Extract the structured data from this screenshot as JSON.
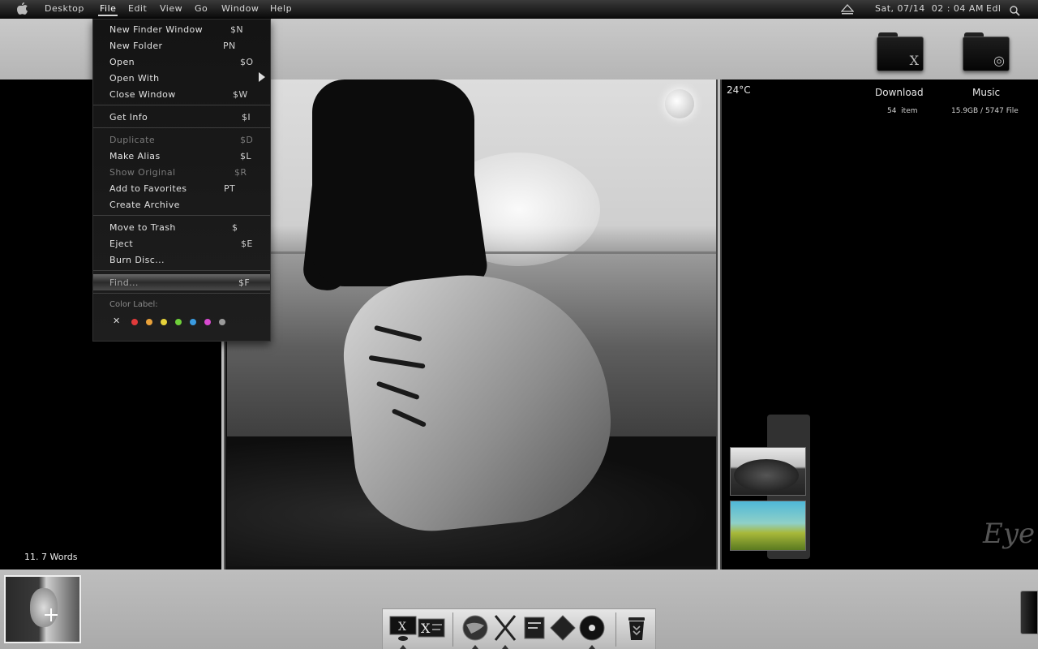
{
  "menubar": {
    "items": [
      "Desktop",
      "File",
      "Edit",
      "View",
      "Go",
      "Window",
      "Help"
    ],
    "datetime": "Sat, 07/14  02 : 04 AM",
    "user": "Edl"
  },
  "file_menu": {
    "items": [
      {
        "label": "New Finder Window",
        "shortcut": "$N"
      },
      {
        "label": "New Folder",
        "shortcut": "PN"
      },
      {
        "label": "Open",
        "shortcut": "$O"
      },
      {
        "label": "Open With",
        "shortcut": ""
      },
      {
        "label": "Close Window",
        "shortcut": "$W"
      },
      {
        "label": "Get Info",
        "shortcut": "$I"
      },
      {
        "label": "Duplicate",
        "shortcut": "$D"
      },
      {
        "label": "Make Alias",
        "shortcut": "$L"
      },
      {
        "label": "Show Original",
        "shortcut": "$R"
      },
      {
        "label": "Add to Favorites",
        "shortcut": "PT"
      },
      {
        "label": "Create Archive",
        "shortcut": ""
      },
      {
        "label": "Move to Trash",
        "shortcut": "$"
      },
      {
        "label": "Eject",
        "shortcut": "$E"
      },
      {
        "label": "Burn Disc...",
        "shortcut": ""
      },
      {
        "label": "Find...",
        "shortcut": "$F"
      }
    ],
    "color_label_title": "Color Label:",
    "color_label_clear": "✕",
    "color_labels": [
      "#e03a3a",
      "#e8a13a",
      "#e6d23a",
      "#6fcf3a",
      "#3a9be0",
      "#d84ad0",
      "#9a9a9a"
    ]
  },
  "left_panel": {
    "word_count": "11. 7 Words"
  },
  "right_panel": {
    "temperature": "24°C",
    "download_label": "Download",
    "download_info": "54  item",
    "music_label": "Music",
    "music_info": "15.9GB / 5747 File",
    "signature": "Eye"
  },
  "desktop": {
    "folders": [
      {
        "name": "x-folder",
        "glyph": "X"
      },
      {
        "name": "music-folder",
        "glyph": "◎"
      }
    ]
  },
  "colors": {
    "menubar": "#1a1a1a",
    "panel": "#000000",
    "band": "#bdbdbd",
    "highlight": "#6a6a6a"
  },
  "dock": {
    "icons": [
      "finder-icon",
      "terminal-icon",
      "globe-icon",
      "x-icon",
      "notes-icon",
      "diamond-icon",
      "cd-icon",
      "trash-icon"
    ]
  }
}
